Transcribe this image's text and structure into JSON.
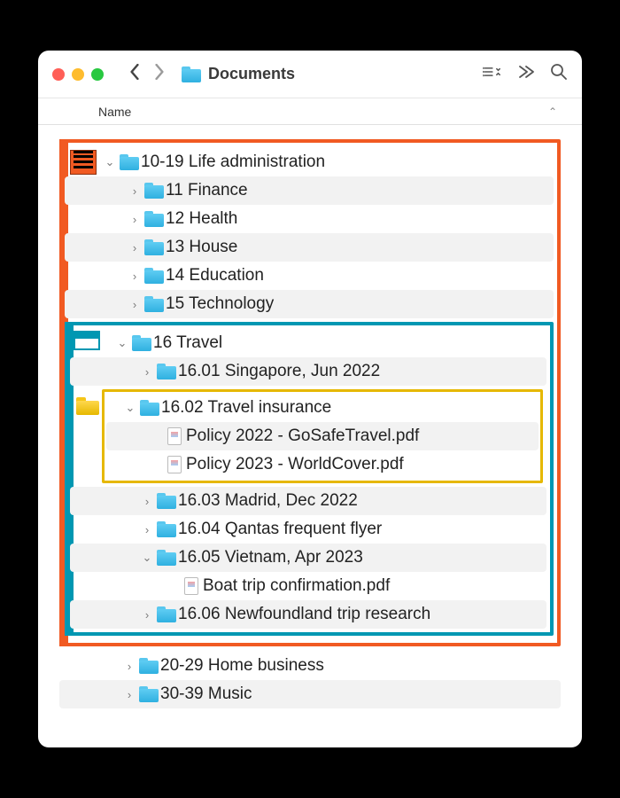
{
  "titlebar": {
    "title": "Documents"
  },
  "column": {
    "name": "Name"
  },
  "tree": {
    "life_admin": "10-19 Life administration",
    "finance": "11 Finance",
    "health": "12 Health",
    "house": "13 House",
    "education": "14 Education",
    "technology": "15 Technology",
    "travel": "16 Travel",
    "singapore": "16.01 Singapore, Jun 2022",
    "insurance": "16.02 Travel insurance",
    "policy22": "Policy 2022 - GoSafeTravel.pdf",
    "policy23": "Policy 2023 - WorldCover.pdf",
    "madrid": "16.03 Madrid, Dec 2022",
    "qantas": "16.04 Qantas frequent flyer",
    "vietnam": "16.05 Vietnam, Apr 2023",
    "boat": "Boat trip confirmation.pdf",
    "newfoundland": "16.06 Newfoundland trip research",
    "business": "20-29 Home business",
    "music": "30-39 Music"
  }
}
